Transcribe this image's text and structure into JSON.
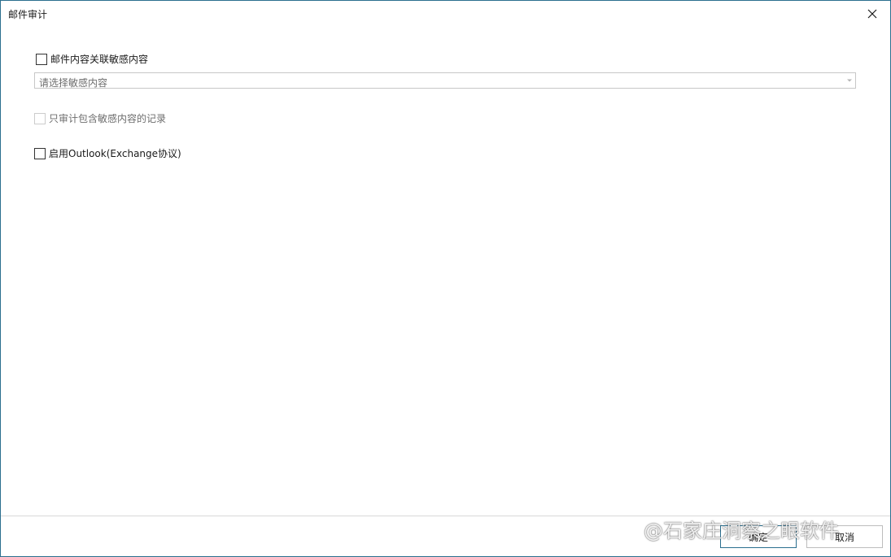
{
  "window": {
    "title": "邮件审计"
  },
  "options": {
    "mail_content_label": "邮件内容关联敏感内容",
    "mail_content_checked": false,
    "sensitive_select_placeholder": "请选择敏感内容",
    "only_sensitive_label": "只审计包含敏感内容的记录",
    "only_sensitive_enabled": false,
    "outlook_label": "启用Outlook(Exchange协议)",
    "outlook_checked": false
  },
  "footer": {
    "ok_label": "确定",
    "cancel_label": "取消"
  },
  "watermark": {
    "text": "@石家庄洞察之眼软件"
  },
  "colors": {
    "window_border": "#2b6f8f",
    "primary_button_border": "#2b6f8f"
  }
}
